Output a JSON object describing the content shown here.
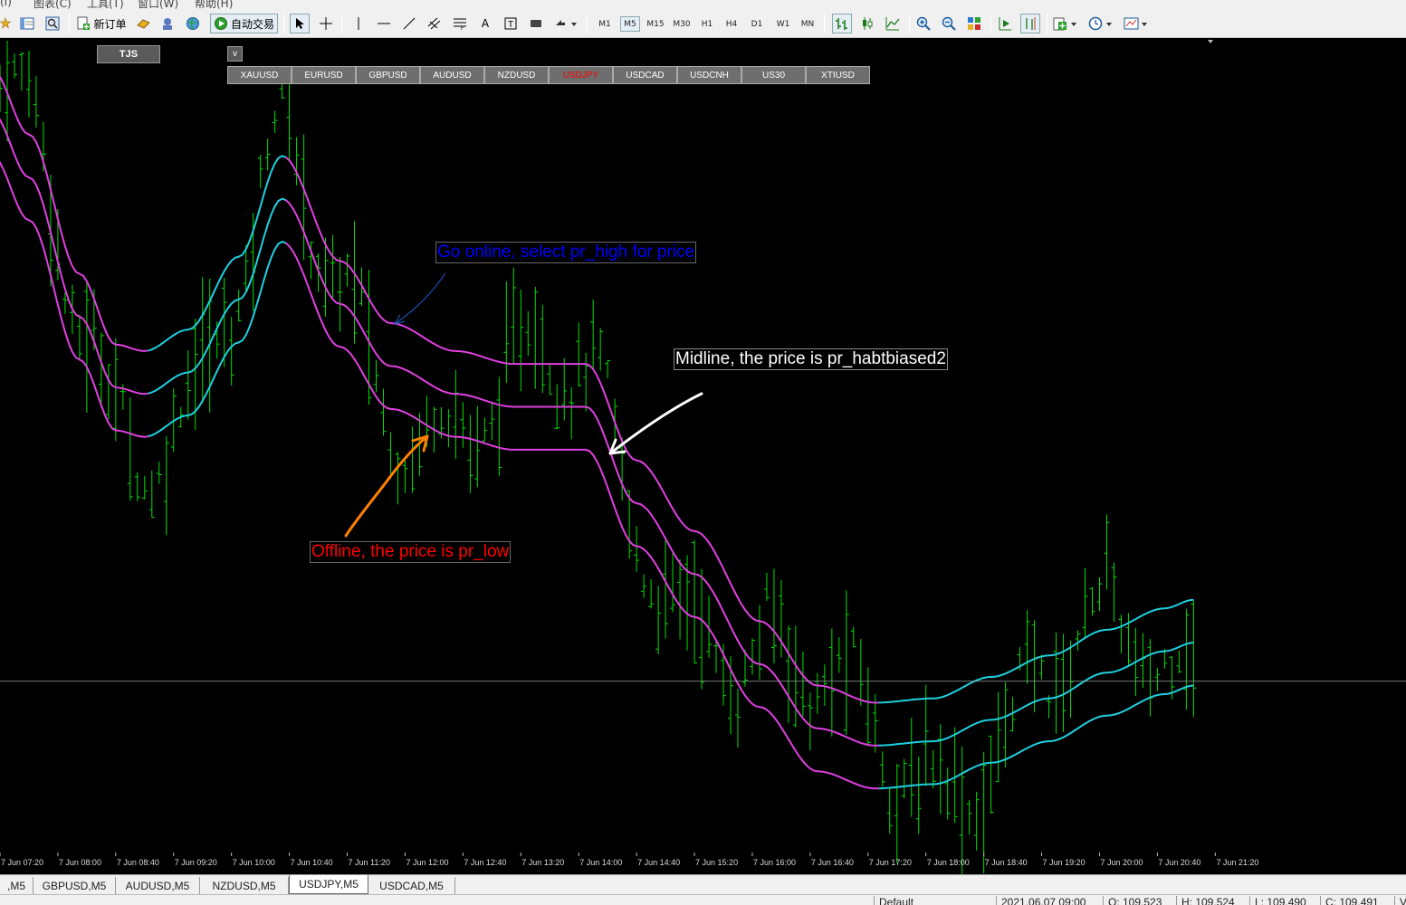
{
  "menubar": {
    "items": [
      "(I)",
      "图表(C)",
      "工具(T)",
      "窗口(W)",
      "帮助(H)"
    ]
  },
  "toolbar": {
    "new_order_label": "新订单",
    "auto_trade_label": "自动交易",
    "timeframes": [
      "M1",
      "M5",
      "M15",
      "M30",
      "H1",
      "H4",
      "D1",
      "W1",
      "MN"
    ],
    "active_timeframe": "M5"
  },
  "chart_panel": {
    "tjs_label": "TJS",
    "v_label": "v",
    "symbols": [
      "XAUUSD",
      "EURUSD",
      "GBPUSD",
      "AUDUSD",
      "NZDUSD",
      "USDJPY",
      "USDCAD",
      "USDCNH",
      "US30",
      "XTIUSD"
    ],
    "active_symbol": "USDJPY",
    "active_color": "#ff0000"
  },
  "annotations": {
    "online": "Go online, select pr_high for price",
    "midline": "Midline, the price is pr_habtbiased2",
    "offline": "Offline, the price is pr_low"
  },
  "colors": {
    "candle": "#00e000",
    "band_magenta": "#e040e0",
    "band_cyan": "#20d0e0",
    "annot_online": "#0000ff",
    "annot_offline": "#ff0000",
    "arrow_orange": "#ff8000",
    "arrow_white": "#ffffff",
    "arrow_blue": "#2060d0"
  },
  "chart_data": {
    "type": "line",
    "symbol": "USDJPY",
    "timeframe": "M5",
    "x_tick_labels": [
      "7 Jun 07:20",
      "7 Jun 08:00",
      "7 Jun 08:40",
      "7 Jun 09:20",
      "7 Jun 10:00",
      "7 Jun 10:40",
      "7 Jun 11:20",
      "7 Jun 12:00",
      "7 Jun 12:40",
      "7 Jun 13:20",
      "7 Jun 14:00",
      "7 Jun 14:40",
      "7 Jun 15:20",
      "7 Jun 16:00",
      "7 Jun 16:40",
      "7 Jun 17:20",
      "7 Jun 18:00",
      "7 Jun 18:40",
      "7 Jun 19:20",
      "7 Jun 20:00",
      "7 Jun 20:40",
      "7 Jun 21:20"
    ],
    "x_tick_index": [
      0,
      8,
      16,
      24,
      32,
      40,
      48,
      56,
      64,
      72,
      80,
      88,
      96,
      104,
      112,
      120,
      128,
      136,
      144,
      152,
      160,
      168
    ],
    "series": [
      {
        "role": "upper",
        "values": [
          [
            -2,
            109.735
          ],
          [
            3,
            109.705
          ],
          [
            10,
            109.64
          ],
          [
            15,
            109.607
          ],
          [
            19,
            109.604
          ],
          [
            25,
            109.614
          ],
          [
            32,
            109.648
          ],
          [
            38,
            109.695
          ],
          [
            46,
            109.646
          ],
          [
            53,
            109.617
          ],
          [
            62,
            109.604
          ],
          [
            70,
            109.598
          ],
          [
            80,
            109.598
          ],
          [
            87,
            109.553
          ],
          [
            95,
            109.52
          ],
          [
            104,
            109.478
          ],
          [
            112,
            109.448
          ],
          [
            120,
            109.44
          ],
          [
            128,
            109.442
          ],
          [
            136,
            109.452
          ],
          [
            144,
            109.462
          ],
          [
            152,
            109.474
          ],
          [
            160,
            109.484
          ],
          [
            164,
            109.488
          ]
        ]
      },
      {
        "role": "middle",
        "values": [
          [
            -2,
            109.715
          ],
          [
            3,
            109.685
          ],
          [
            10,
            109.62
          ],
          [
            15,
            109.587
          ],
          [
            19,
            109.584
          ],
          [
            25,
            109.594
          ],
          [
            32,
            109.628
          ],
          [
            38,
            109.675
          ],
          [
            46,
            109.626
          ],
          [
            53,
            109.597
          ],
          [
            62,
            109.584
          ],
          [
            70,
            109.578
          ],
          [
            80,
            109.578
          ],
          [
            87,
            109.533
          ],
          [
            95,
            109.5
          ],
          [
            104,
            109.458
          ],
          [
            112,
            109.428
          ],
          [
            120,
            109.42
          ],
          [
            128,
            109.422
          ],
          [
            136,
            109.432
          ],
          [
            144,
            109.442
          ],
          [
            152,
            109.454
          ],
          [
            160,
            109.464
          ],
          [
            164,
            109.468
          ]
        ]
      },
      {
        "role": "lower",
        "values": [
          [
            -2,
            109.695
          ],
          [
            3,
            109.665
          ],
          [
            10,
            109.6
          ],
          [
            15,
            109.567
          ],
          [
            19,
            109.564
          ],
          [
            25,
            109.574
          ],
          [
            32,
            109.608
          ],
          [
            38,
            109.655
          ],
          [
            46,
            109.606
          ],
          [
            53,
            109.577
          ],
          [
            62,
            109.564
          ],
          [
            70,
            109.558
          ],
          [
            80,
            109.558
          ],
          [
            87,
            109.513
          ],
          [
            95,
            109.48
          ],
          [
            104,
            109.438
          ],
          [
            112,
            109.408
          ],
          [
            120,
            109.4
          ],
          [
            128,
            109.402
          ],
          [
            136,
            109.412
          ],
          [
            144,
            109.422
          ],
          [
            152,
            109.434
          ],
          [
            160,
            109.444
          ],
          [
            164,
            109.448
          ]
        ]
      }
    ],
    "ylim": [
      109.36,
      109.75
    ],
    "current_price_line": 109.45,
    "ohlc_readout": {
      "profile": "Default",
      "datetime": "2021.06.07 09:00",
      "open": "O: 109.523",
      "high": "H: 109.524",
      "low": "L: 109.490",
      "close": "C: 109.491"
    }
  },
  "tabs": {
    "items": [
      ",M5",
      "GBPUSD,M5",
      "AUDUSD,M5",
      "NZDUSD,M5",
      "USDJPY,M5",
      "USDCAD,M5"
    ],
    "active": "USDJPY,M5"
  },
  "status": {
    "profile": "Default",
    "datetime": "2021.06.07 09:00",
    "open": "O: 109.523",
    "high": "H: 109.524",
    "low": "L: 109.490",
    "close": "C: 109.491",
    "volume": "V"
  }
}
